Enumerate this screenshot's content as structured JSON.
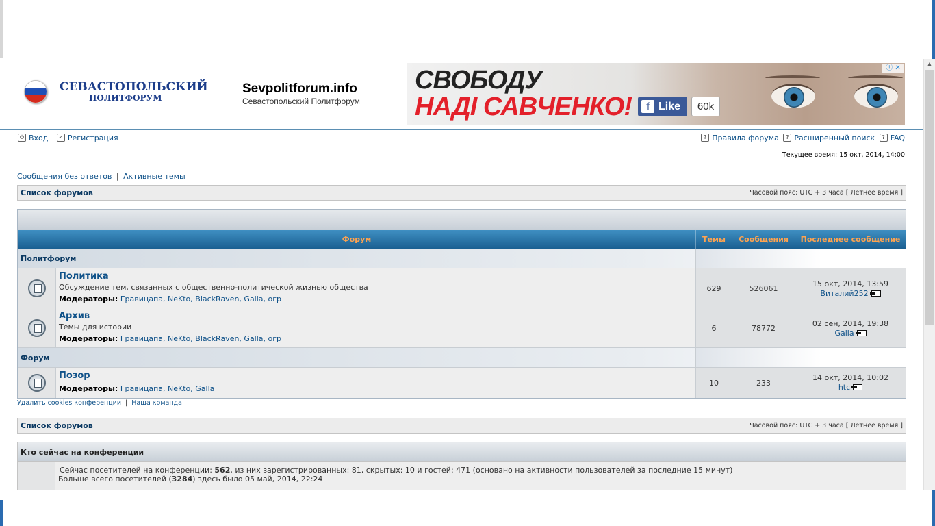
{
  "header": {
    "logo_line1": "СЕВАСТОПОЛЬСКИЙ",
    "logo_line2": "ПОЛИТФОРУМ",
    "site_name": "Sevpolitforum.info",
    "site_desc": "Севастопольский Политфорум"
  },
  "banner": {
    "line1": "СВОБОДУ",
    "line2": "НАДІ САВЧЕНКО!",
    "like_label": "Like",
    "like_count": "60k",
    "adchoices": "ⓘ ✕"
  },
  "nav": {
    "login": "Вход",
    "register": "Регистрация",
    "rules": "Правила форума",
    "search": "Расширенный поиск",
    "faq": "FAQ"
  },
  "current_time": "Текущее время: 15 окт, 2014, 14:00",
  "quick": {
    "unanswered": "Сообщения без ответов",
    "separator": "|",
    "active": "Активные темы"
  },
  "navbar": {
    "title": "Список форумов",
    "timezone": "Часовой пояс: UTC + 3 часа [ Летнее время ]"
  },
  "table": {
    "headers": {
      "forum": "Форум",
      "topics": "Темы",
      "posts": "Сообщения",
      "last": "Последнее сообщение"
    },
    "categories": [
      {
        "title": "Политфорум"
      },
      {
        "title": "Форум"
      }
    ],
    "forums": [
      {
        "title": "Политика",
        "desc": "Обсуждение тем, связанных с общественно-политической жизнью общества",
        "mods_label": "Модераторы:",
        "mods": "Гравицапа, NeKto, BlackRaven, Galla, огр",
        "topics": "629",
        "posts": "526061",
        "last_date": "15 окт, 2014, 13:59",
        "last_user": "Виталий252"
      },
      {
        "title": "Архив",
        "desc": "Темы для истории",
        "mods_label": "Модераторы:",
        "mods": "Гравицапа, NeKto, BlackRaven, Galla, огр",
        "topics": "6",
        "posts": "78772",
        "last_date": "02 сен, 2014, 19:38",
        "last_user": "Galla"
      },
      {
        "title": "Позор",
        "desc": "",
        "mods_label": "Модераторы:",
        "mods": "Гравицапа, NeKto, Galla",
        "topics": "10",
        "posts": "233",
        "last_date": "14 окт, 2014, 10:02",
        "last_user": "htc"
      }
    ]
  },
  "footer": {
    "delete_cookies": "Удалить cookies конференции",
    "separator": "|",
    "team": "Наша команда"
  },
  "online": {
    "title": "Кто сейчас на конференции",
    "l1_a": "Сейчас посетителей на конференции: ",
    "l1_total": "562",
    "l1_b": ", из них зарегистрированных: 81, скрытых: 10 и гостей: 471 (основано на активности пользователей за последние 15 минут)",
    "l2_a": "Больше всего посетителей (",
    "l2_max": "3284",
    "l2_b": ") здесь было 05 май, 2014, 22:24"
  },
  "colors": {
    "link": "#105289",
    "header_bar": "#1a5f91",
    "header_text": "#ffa34f",
    "banner_red": "#e3202a"
  },
  "icons": [
    "login-icon",
    "register-icon",
    "rules-icon",
    "search-icon",
    "faq-icon",
    "forum-read-icon",
    "goto-last-post-icon"
  ]
}
